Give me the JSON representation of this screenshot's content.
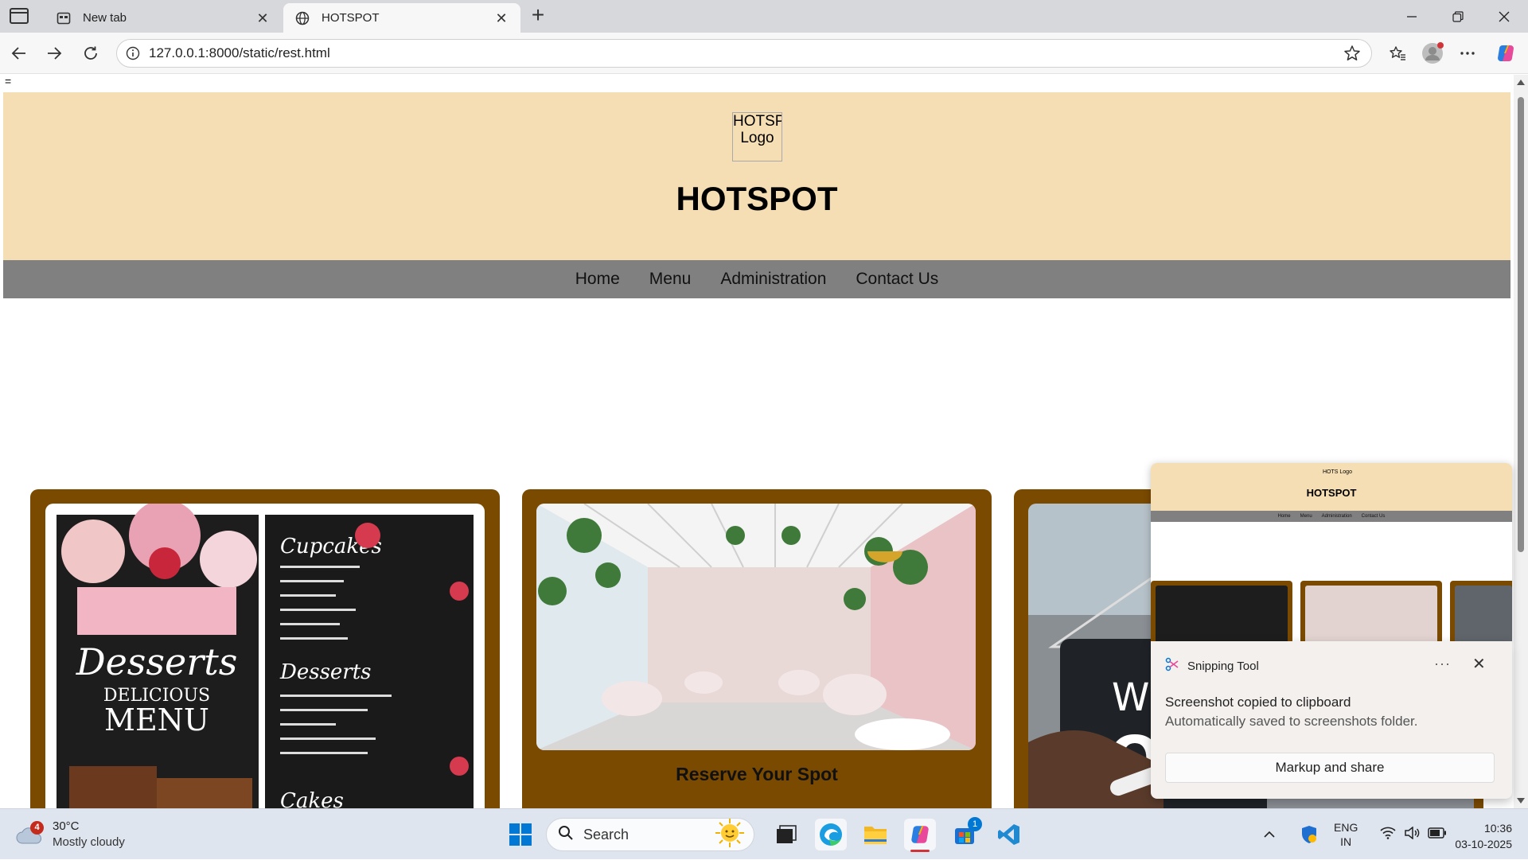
{
  "browser": {
    "tabs": [
      {
        "title": "New tab",
        "active": false,
        "icon": "new-tab-page-icon"
      },
      {
        "title": "HOTSPOT",
        "active": true,
        "icon": "globe-icon"
      }
    ],
    "address": "127.0.0.1:8000/static/rest.html"
  },
  "page": {
    "stray_text": "=",
    "logo_alt": "HOTSPOT Logo",
    "title": "HOTSPOT",
    "nav": [
      "Home",
      "Menu",
      "Administration",
      "Contact Us"
    ],
    "cards": [
      {
        "image": "desserts-menu-board",
        "caption": ""
      },
      {
        "image": "restaurant-interior",
        "caption": "Reserve Your Spot"
      },
      {
        "image": "welcome-open-sign",
        "caption": ""
      }
    ]
  },
  "snipping_preview": {
    "logo_text": "HOTS Logo",
    "title": "HOTSPOT",
    "nav": [
      "Home",
      "Menu",
      "Administration",
      "Contact Us"
    ]
  },
  "toast": {
    "app": "Snipping Tool",
    "more": "···",
    "message": "Screenshot copied to clipboard",
    "sub": "Automatically saved to screenshots folder.",
    "button": "Markup and share"
  },
  "taskbar": {
    "weather": {
      "temp": "30°C",
      "desc": "Mostly cloudy",
      "badge": "4"
    },
    "search_placeholder": "Search",
    "store_badge": "1",
    "lang": {
      "line1": "ENG",
      "line2": "IN"
    },
    "clock": {
      "time": "10:36",
      "date": "03-10-2025"
    }
  },
  "colors": {
    "header_bg": "#f5deb3",
    "nav_bg": "#808080",
    "card_bg": "#7a4a00",
    "accent": "#0078d4"
  }
}
